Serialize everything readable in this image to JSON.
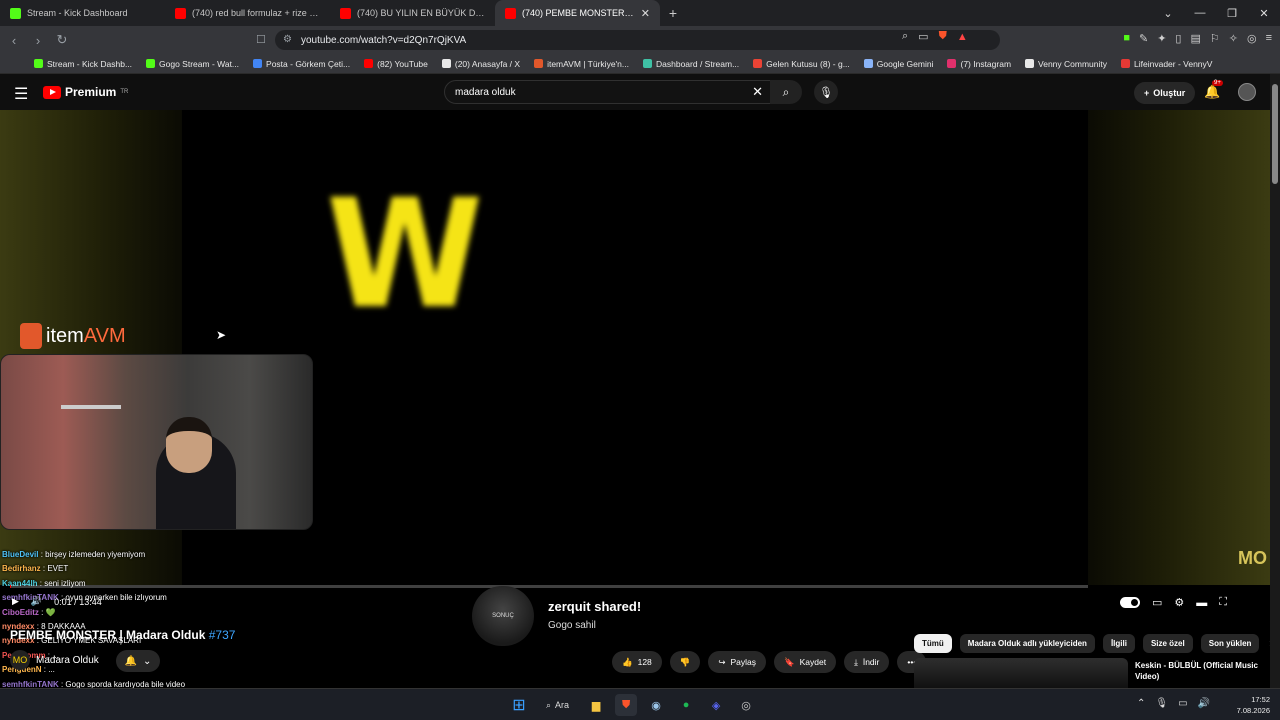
{
  "browser": {
    "tabs": [
      {
        "label": "Stream - Kick Dashboard",
        "color": "#53fc18",
        "active": false
      },
      {
        "label": "(740) red bull formulaz + rize vlog -",
        "color": "#ff0000",
        "active": false
      },
      {
        "label": "(740) BU YILIN EN BÜYÜK DRAMASI",
        "color": "#ff0000",
        "active": false
      },
      {
        "label": "(740) PEMBE MONSTER | Madara",
        "color": "#ff0000",
        "active": true
      }
    ],
    "url": "youtube.com/watch?v=d2Qn7rQjKVA",
    "bookmarks": [
      {
        "label": "Stream - Kick Dashb...",
        "color": "#53fc18"
      },
      {
        "label": "Gogo Stream - Wat...",
        "color": "#53fc18"
      },
      {
        "label": "Posta - Görkem Çeti...",
        "color": "#4285f4"
      },
      {
        "label": "(82) YouTube",
        "color": "#ff0000"
      },
      {
        "label": "(20) Anasayfa / X",
        "color": "#e8e8e8"
      },
      {
        "label": "itemAVM | Türkiye'n...",
        "color": "#e2582b"
      },
      {
        "label": "Dashboard / Stream...",
        "color": "#3fc1a5"
      },
      {
        "label": "Gelen Kutusu (8) - g...",
        "color": "#ea4335"
      },
      {
        "label": "Google Gemini",
        "color": "#8ab4f8"
      },
      {
        "label": "(7) Instagram",
        "color": "#e1306c"
      },
      {
        "label": "Venny Community",
        "color": "#e8e8e8"
      },
      {
        "label": "Lifeinvader - VennyV",
        "color": "#e53935"
      }
    ]
  },
  "youtube": {
    "logo_text": "Premium",
    "logo_region": "TR",
    "search_value": "madara olduk",
    "create_label": "Oluştur",
    "notification_count": "9+"
  },
  "stream": {
    "sponsor_prefix": "item",
    "sponsor_suffix": "AVM",
    "big_letter": "W",
    "watermark": "MO"
  },
  "chat": [
    {
      "user": "BlueDevil",
      "color": "#4fc3f7",
      "text": "birşey izlemeden yiyemiyom"
    },
    {
      "user": "Bedirhanz",
      "color": "#ffb74d",
      "text": "EVET"
    },
    {
      "user": "Kaan44lh",
      "color": "#4dd0e1",
      "text": "seni izliyom"
    },
    {
      "user": "semhfkinTANK",
      "color": "#9575cd",
      "text": "oyun oynarken bile izlıyorum"
    },
    {
      "user": "CiboEditz",
      "color": "#ba68c8",
      "text": "💚"
    },
    {
      "user": "nyndexx",
      "color": "#ff8a65",
      "text": "8 DAKKAAA"
    },
    {
      "user": "nyndexx",
      "color": "#ff8a65",
      "text": "GELİYO YMEK SAVAŞLARI"
    },
    {
      "user": "Pengoomm",
      "color": "#ef5350",
      "text": "..."
    },
    {
      "user": "PenguenN",
      "color": "#ffb74d",
      "text": "..."
    },
    {
      "user": "semhfkinTANK",
      "color": "#9575cd",
      "text": "Gogo sporda kardıyoda bile video"
    },
    {
      "user": "eneestlhaa",
      "color": "#4dd0e1",
      "text": "şuan bile yiyorum amk seni izlerken"
    },
    {
      "user": "AvaluggLeader",
      "color": "#81c784",
      "text": "şuan yemek yerken, video izleyen seni izliyorum"
    }
  ],
  "player": {
    "time_current": "0:01",
    "time_total": "13:44",
    "progress_fraction": 0.001
  },
  "share_notice": {
    "title": "zerquit shared!",
    "subtitle": "Gogo sahil",
    "avatar_text": "SONUÇ"
  },
  "video": {
    "title": "PEMBE MONSTER | Madara Olduk",
    "episode": "#737",
    "channel": "Madara Olduk",
    "channel_avatar": "MO",
    "likes": "128",
    "share_label": "Paylaş",
    "save_label": "Kaydet",
    "download_label": "İndir"
  },
  "chips": [
    {
      "label": "Tümü",
      "active": true
    },
    {
      "label": "Madara Olduk adlı yükleyiciden",
      "active": false
    },
    {
      "label": "İlgili",
      "active": false
    },
    {
      "label": "Size özel",
      "active": false
    },
    {
      "label": "Son yüklen",
      "active": false
    }
  ],
  "recommendation": {
    "title": "Keskin - BÜLBÜL (Official Music Video)"
  },
  "taskbar": {
    "search_label": "Ara",
    "time": "17:52",
    "date": "7.08.2026"
  }
}
